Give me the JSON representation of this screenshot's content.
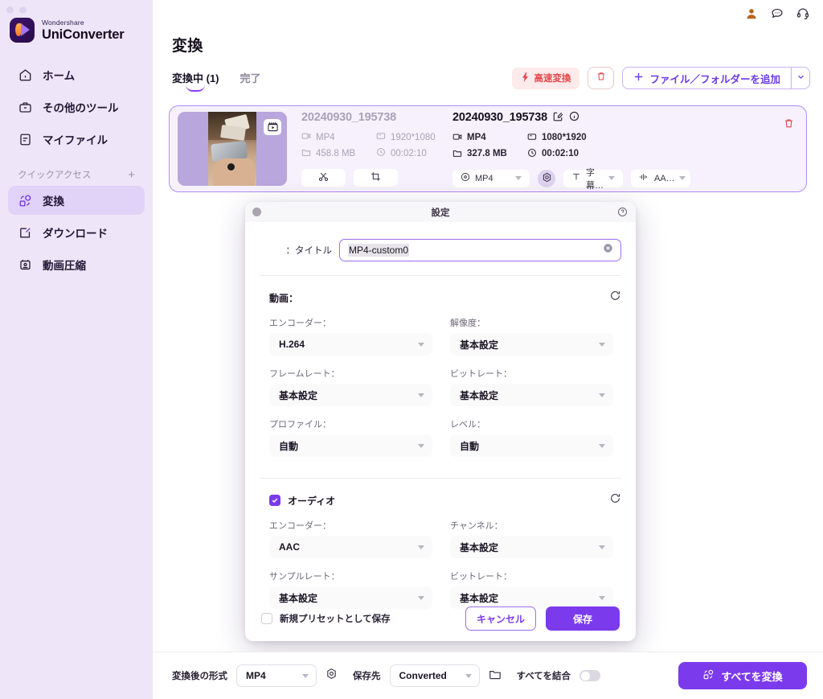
{
  "sidebar": {
    "brand": {
      "sup": "Wondershare",
      "name": "UniConverter"
    },
    "items": [
      {
        "label": "ホーム",
        "icon": "home-icon"
      },
      {
        "label": "その他のツール",
        "icon": "toolbox-icon"
      },
      {
        "label": "マイファイル",
        "icon": "file-icon"
      }
    ],
    "quick_access": {
      "label": "クイックアクセス",
      "add": "+"
    },
    "quick_items": [
      {
        "label": "変換",
        "icon": "convert-icon",
        "active": true
      },
      {
        "label": "ダウンロード",
        "icon": "download-icon",
        "active": false
      },
      {
        "label": "動画圧縮",
        "icon": "compress-icon",
        "active": false
      }
    ]
  },
  "header": {
    "title": "変換",
    "tabs": [
      {
        "label": "変換中 (1)",
        "active": true
      },
      {
        "label": "完了",
        "active": false
      }
    ],
    "speed_button": "高速変換",
    "add_file_button": "ファイル／フォルダーを追加"
  },
  "file_card": {
    "source": {
      "name": "20240930_195738",
      "format": "MP4",
      "resolution": "1920*1080",
      "size": "458.8 MB",
      "duration": "00:02:10"
    },
    "output": {
      "name": "20240930_195738",
      "format": "MP4",
      "resolution": "1080*1920",
      "size": "327.8 MB",
      "duration": "00:02:10",
      "format_select": "MP4",
      "subtitle_select": "字幕…",
      "audio_select": "AA…"
    }
  },
  "modal": {
    "title": "設定",
    "title_label": "タイトル：",
    "title_value": "MP4-custom0",
    "video": {
      "heading": "動画：",
      "fields": [
        {
          "label": "エンコーダー：",
          "value": "H.264"
        },
        {
          "label": "解像度：",
          "value": "基本設定"
        },
        {
          "label": "フレームレート：",
          "value": "基本設定"
        },
        {
          "label": "ビットレート：",
          "value": "基本設定"
        },
        {
          "label": "プロファイル：",
          "value": "自動"
        },
        {
          "label": "レベル：",
          "value": "自動"
        }
      ]
    },
    "audio": {
      "heading": "オーディオ",
      "checked": true,
      "fields": [
        {
          "label": "エンコーダー：",
          "value": "AAC"
        },
        {
          "label": "チャンネル：",
          "value": "基本設定"
        },
        {
          "label": "サンプルレート：",
          "value": "基本設定"
        },
        {
          "label": "ビットレート：",
          "value": "基本設定"
        }
      ]
    },
    "footer": {
      "preset_label": "新規プリセットとして保存",
      "cancel": "キャンセル",
      "save": "保存"
    }
  },
  "bottom_bar": {
    "format_label": "変換後の形式",
    "format_value": "MP4",
    "dest_label": "保存先",
    "dest_value": "Converted",
    "merge_label": "すべてを結合",
    "convert_all": "すべてを変換"
  },
  "colors": {
    "accent": "#7c3aed",
    "sidebar_bg": "#eee6f8",
    "card_bg": "#f6f1fd",
    "danger": "#e5484d"
  }
}
